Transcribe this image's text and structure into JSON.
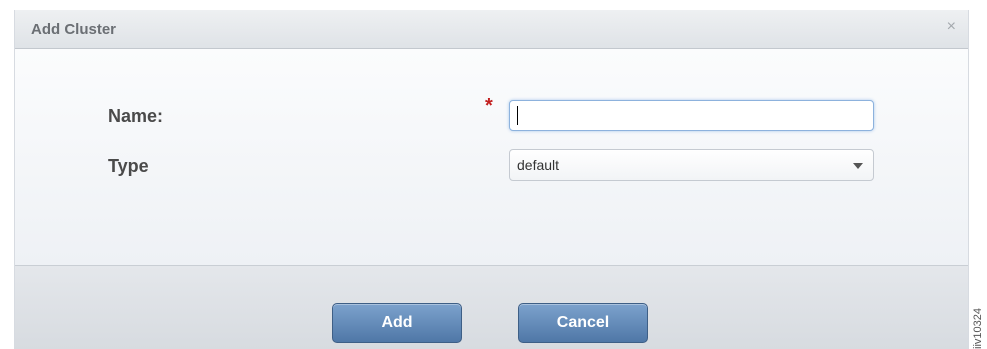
{
  "dialog": {
    "title": "Add Cluster",
    "close_icon": "×"
  },
  "form": {
    "name_label": "Name:",
    "required_marker": "*",
    "name_value": "",
    "type_label": "Type",
    "type_selected": "default"
  },
  "footer": {
    "add_label": "Add",
    "cancel_label": "Cancel"
  },
  "watermark": "iiv10324"
}
